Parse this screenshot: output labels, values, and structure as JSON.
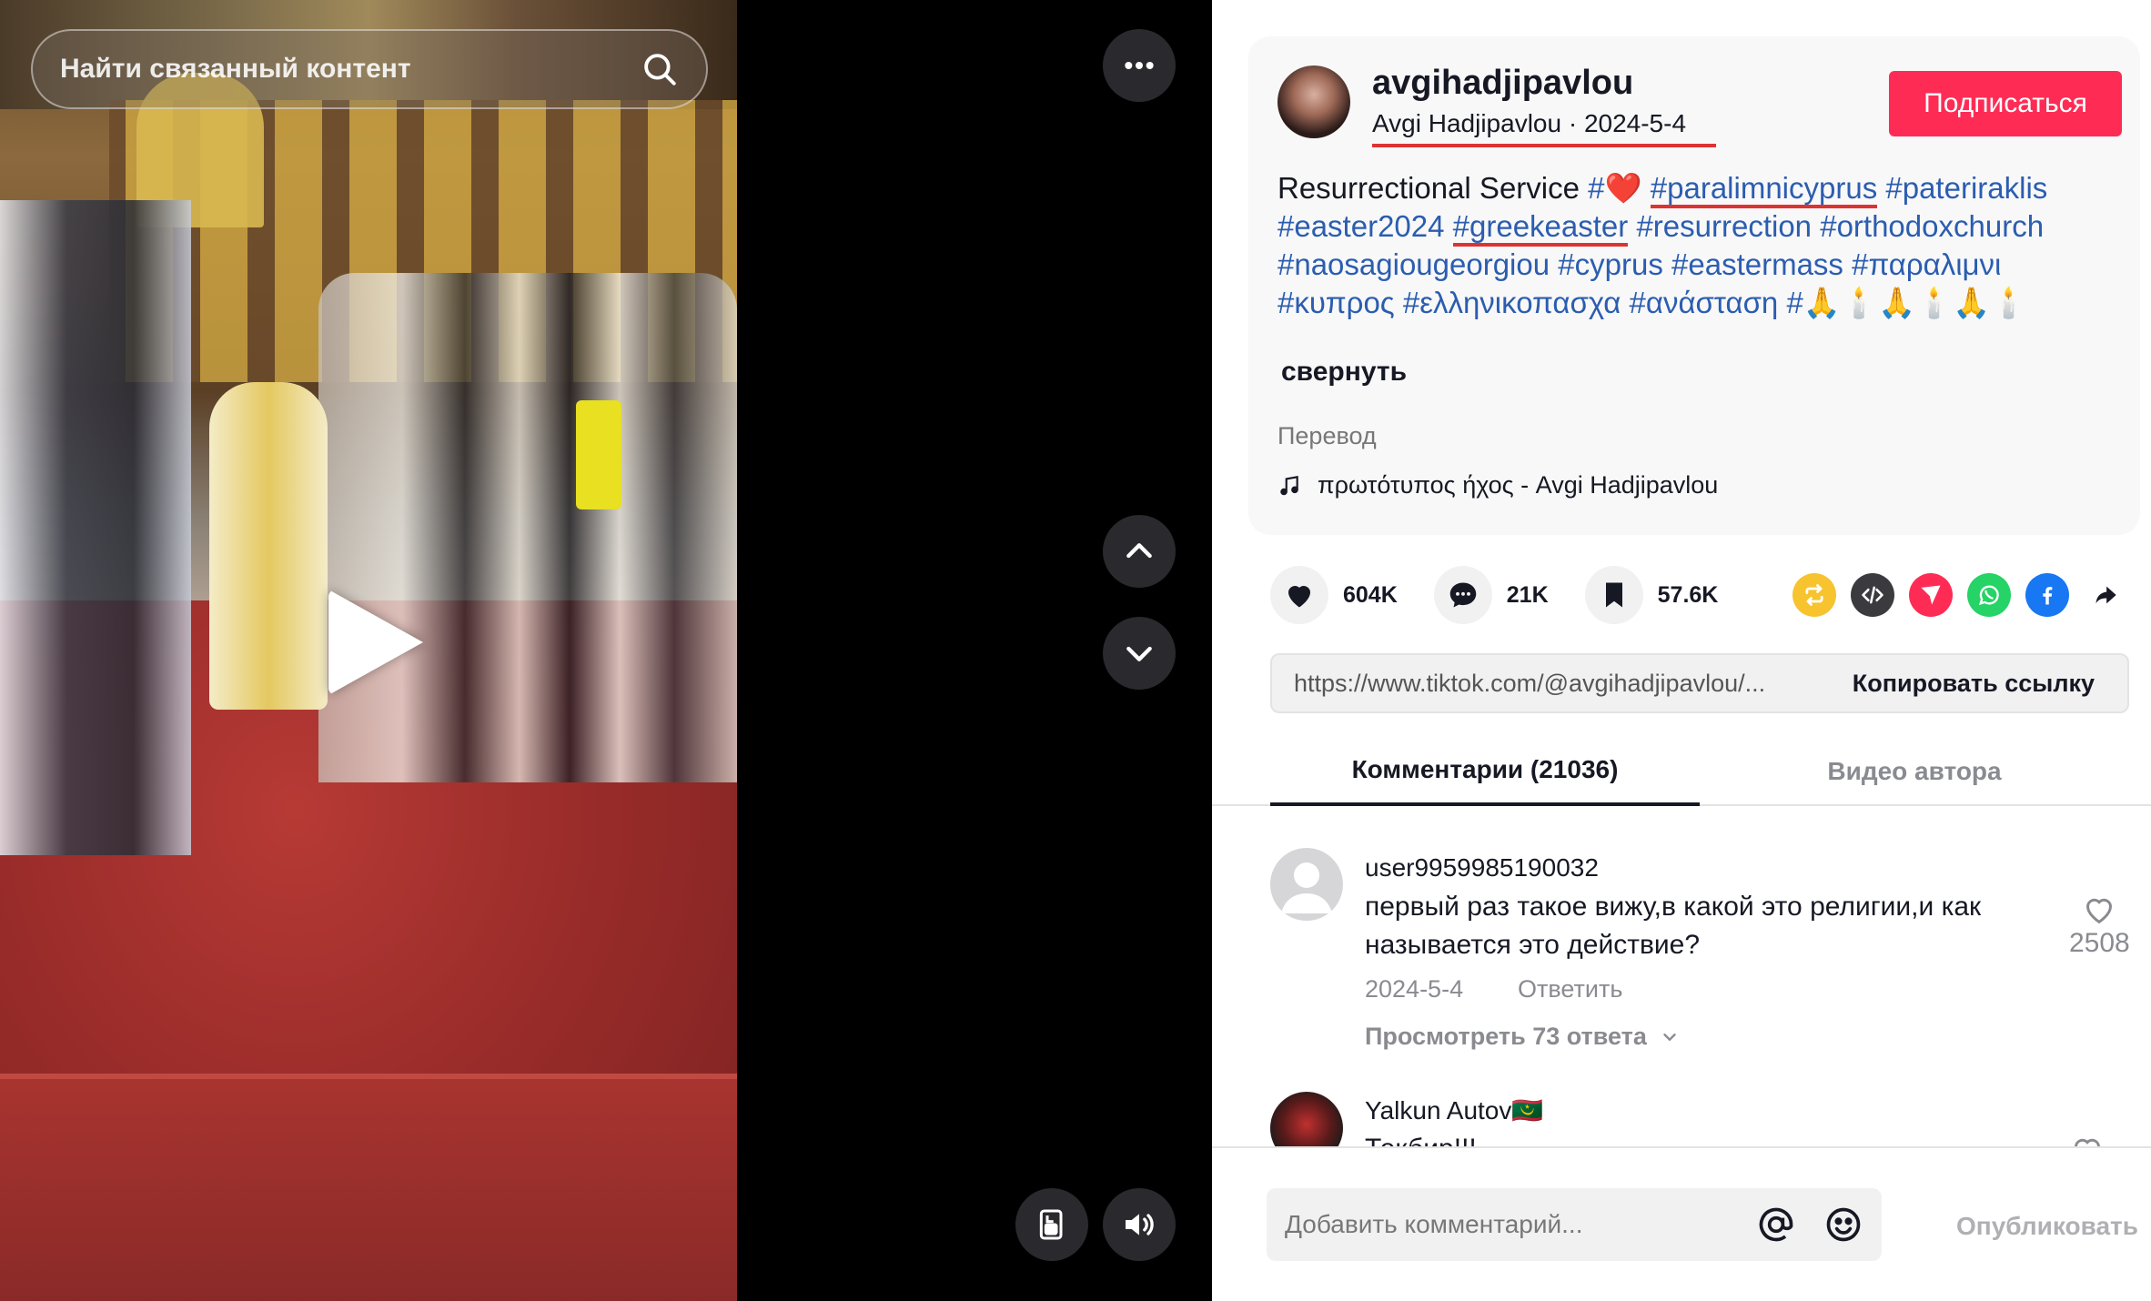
{
  "video": {
    "search_placeholder": "Найти связанный контент",
    "icons": [
      "search-icon",
      "more-icon",
      "play-icon",
      "chevron-up-icon",
      "chevron-down-icon",
      "mini-player-icon",
      "volume-icon"
    ]
  },
  "author": {
    "username": "avgihadjipavlou",
    "display_meta": "Avgi Hadjipavlou · 2024-5-4",
    "follow_label": "Подписаться"
  },
  "caption": {
    "text": "Resurrectional Service",
    "tags": [
      "#",
      "#paralimnicyprus",
      "#pateriraklis",
      "#easter2024",
      "#greekeaster",
      "#resurrection",
      "#orthodoxchurch",
      "#naosagiougeorgiou",
      "#cyprus",
      "#eastermass",
      "#παραλιμνι",
      "#κυπρος",
      "#ελληνικοπασχα",
      "#ανάσταση",
      "#"
    ],
    "heart": "❤️",
    "trailing_emoji": "🙏🕯️🙏🕯️🙏🕯️"
  },
  "collapse_label": "свернуть",
  "translate_label": "Перевод",
  "music": "πρωτότυπος ήχος - Avgi Hadjipavlou",
  "stats": {
    "likes": "604K",
    "comments": "21K",
    "saves": "57.6K"
  },
  "share_colors": {
    "repost": "#f7c32e",
    "embed": "#3b3b3f",
    "send": "#fe2c55",
    "whatsapp": "#25d366",
    "facebook": "#1877f2"
  },
  "link": {
    "url": "https://www.tiktok.com/@avgihadjipavlou/...",
    "copy_label": "Копировать ссылку"
  },
  "tabs": {
    "comments": "Комментарии (21036)",
    "creator_videos": "Видео автора"
  },
  "comments": [
    {
      "user": "user9959985190032",
      "text": "первый раз такое вижу,в какой это религии,и как называется это действие?",
      "date": "2024-5-4",
      "reply_label": "Ответить",
      "likes": "2508",
      "view_replies": "Просмотреть 73 ответа"
    },
    {
      "user": "Yalkun Autov🇲🇷",
      "text": "Текбир!!!"
    }
  ],
  "composer": {
    "placeholder": "Добавить комментарий...",
    "post_label": "Опубликовать"
  }
}
